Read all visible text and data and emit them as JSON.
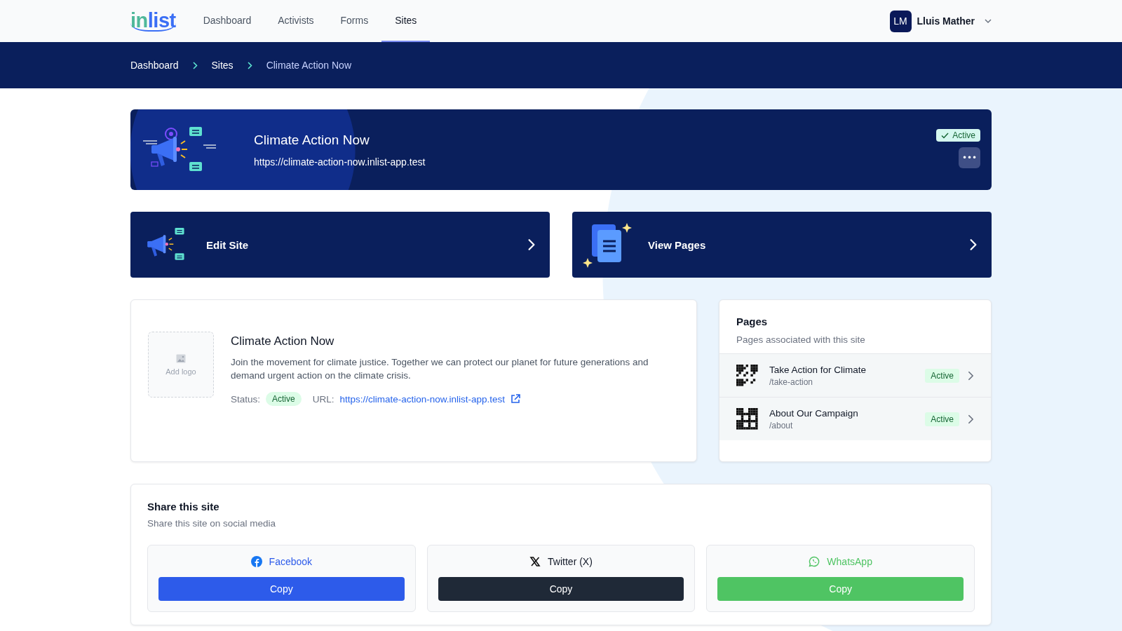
{
  "logo": {
    "lead": "in",
    "rest": "list"
  },
  "nav": [
    {
      "label": "Dashboard",
      "selected": false
    },
    {
      "label": "Activists",
      "selected": false
    },
    {
      "label": "Forms",
      "selected": false
    },
    {
      "label": "Sites",
      "selected": true
    }
  ],
  "user": {
    "initials": "LM",
    "name": "Lluis Mather"
  },
  "breadcrumbs": [
    "Dashboard",
    "Sites",
    "Climate Action Now"
  ],
  "hero": {
    "title": "Climate Action Now",
    "url": "https://climate-action-now.inlist-app.test",
    "badge": "Active",
    "menu": "•••"
  },
  "actions": [
    {
      "kind": "edit",
      "label": "Edit Site"
    },
    {
      "kind": "pages",
      "label": "View Pages"
    }
  ],
  "site": {
    "logo_placeholder": "Add logo",
    "title": "Climate Action Now",
    "description": "Join the movement for climate justice. Together we can protect our planet for future generations and demand urgent action on the climate crisis.",
    "status_label": "Status:",
    "status": "Active",
    "url_label": "URL:",
    "url": "https://climate-action-now.inlist-app.test"
  },
  "pages": {
    "title": "Pages",
    "subtitle": "Pages associated with this site",
    "items": [
      {
        "title": "Take Action for Climate",
        "path": "/take-action",
        "status": "Active"
      },
      {
        "title": "About Our Campaign",
        "path": "/about",
        "status": "Active"
      }
    ]
  },
  "share": {
    "title": "Share this site",
    "subtitle": "Share this site on social media",
    "items": [
      {
        "kind": "facebook",
        "label": "Facebook",
        "button": "Copy"
      },
      {
        "kind": "twitter",
        "label": "Twitter (X)",
        "button": "Copy"
      },
      {
        "kind": "whatsapp",
        "label": "WhatsApp",
        "button": "Copy"
      }
    ]
  }
}
